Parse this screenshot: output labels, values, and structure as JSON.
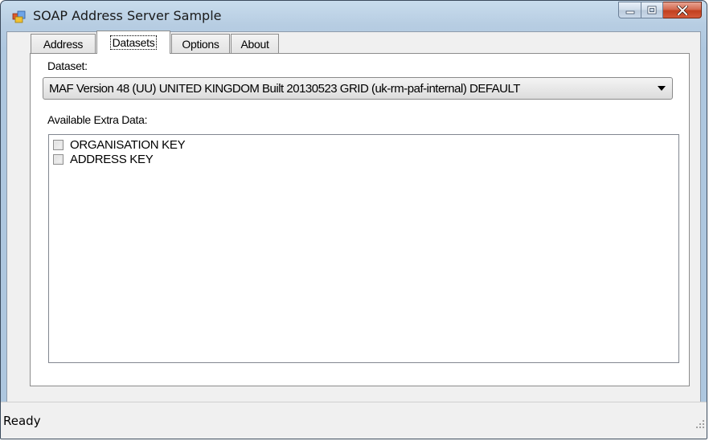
{
  "window": {
    "title": "SOAP Address Server Sample",
    "app_icon": "form-icon",
    "controls": {
      "minimize_icon": "minimize-icon",
      "maximize_icon": "maximize-icon",
      "close_icon": "close-icon"
    },
    "colors": {
      "titlebar": "#b7cde2",
      "close_button": "#c2401f",
      "client": "#f0f0f0"
    }
  },
  "tabs": [
    {
      "label": "Address",
      "active": false
    },
    {
      "label": "Datasets",
      "active": true
    },
    {
      "label": "Options",
      "active": false
    },
    {
      "label": "About",
      "active": false
    }
  ],
  "datasets_tab": {
    "dataset_label": "Dataset:",
    "dataset_selected": "MAF Version 48 (UU)  UNITED KINGDOM  Built 20130523 GRID (uk-rm-paf-internal) DEFAULT",
    "extra_data_label": "Available Extra Data:",
    "extra_data_items": [
      {
        "label": "ORGANISATION KEY",
        "checked": false
      },
      {
        "label": "ADDRESS KEY",
        "checked": false
      }
    ]
  },
  "status": {
    "text": "Ready"
  }
}
